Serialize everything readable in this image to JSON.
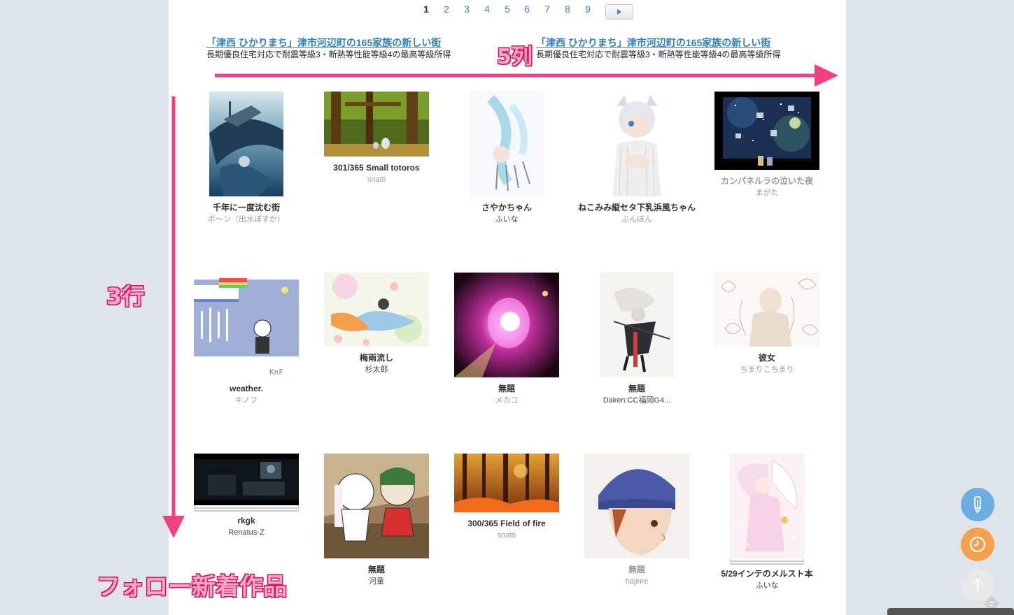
{
  "pagination": {
    "pages": [
      "1",
      "2",
      "3",
      "4",
      "5",
      "6",
      "7",
      "8",
      "9"
    ],
    "current": "1",
    "next_icon": "play-triangle-icon"
  },
  "ads": [
    {
      "title": "「津西 ひかりまち」津市河辺町の165家族の新しい街",
      "desc": "長期優良住宅対応で耐震等級3・断熱等性能等級4の最高等級所得"
    },
    {
      "title": "「津西 ひかりまち」津市河辺町の165家族の新しい街",
      "desc": "長期優良住宅対応で耐震等級3・断熱等性能等級4の最高等級所得"
    }
  ],
  "annotations": {
    "columns": "5列",
    "rows": "3行",
    "caption": "フォロー新着作品",
    "color": "#f0407f"
  },
  "works": [
    {
      "title": "千年に一度沈む街",
      "user": "ポ〜ン（出水ぽすか）"
    },
    {
      "title": "301/365 Small totoros",
      "user": "snatti"
    },
    {
      "title": "さやかちゃん",
      "user": "ふいな"
    },
    {
      "title": "ねこみみ縦セタ下乳浜風ちゃん",
      "user": "ぶんぼん"
    },
    {
      "title": "カンパネルラの泣いた夜",
      "user": "まがた"
    },
    {
      "title": "weather.",
      "user": "キノフ"
    },
    {
      "title": "梅雨流し",
      "user": "杉太郎"
    },
    {
      "title": "無題",
      "user": "メカコ"
    },
    {
      "title": "無題",
      "user": "Daken:CC福岡G4..."
    },
    {
      "title": "彼女",
      "user": "ちまりこちまり"
    },
    {
      "title": "rkgk",
      "user": "Renatus·Z"
    },
    {
      "title": "無題",
      "user": "河童"
    },
    {
      "title": "300/365 Field of fire",
      "user": "snatti"
    },
    {
      "title": "無題",
      "user": "hajime"
    },
    {
      "title": "5/29インテのメルスト本",
      "user": "ふいな"
    }
  ],
  "fabs": [
    {
      "name": "pencil-icon",
      "color": "#6aaee3"
    },
    {
      "name": "clock-icon",
      "color": "#f5a04a"
    },
    {
      "name": "arrow-up-icon",
      "color": "#e8e8e8"
    }
  ]
}
